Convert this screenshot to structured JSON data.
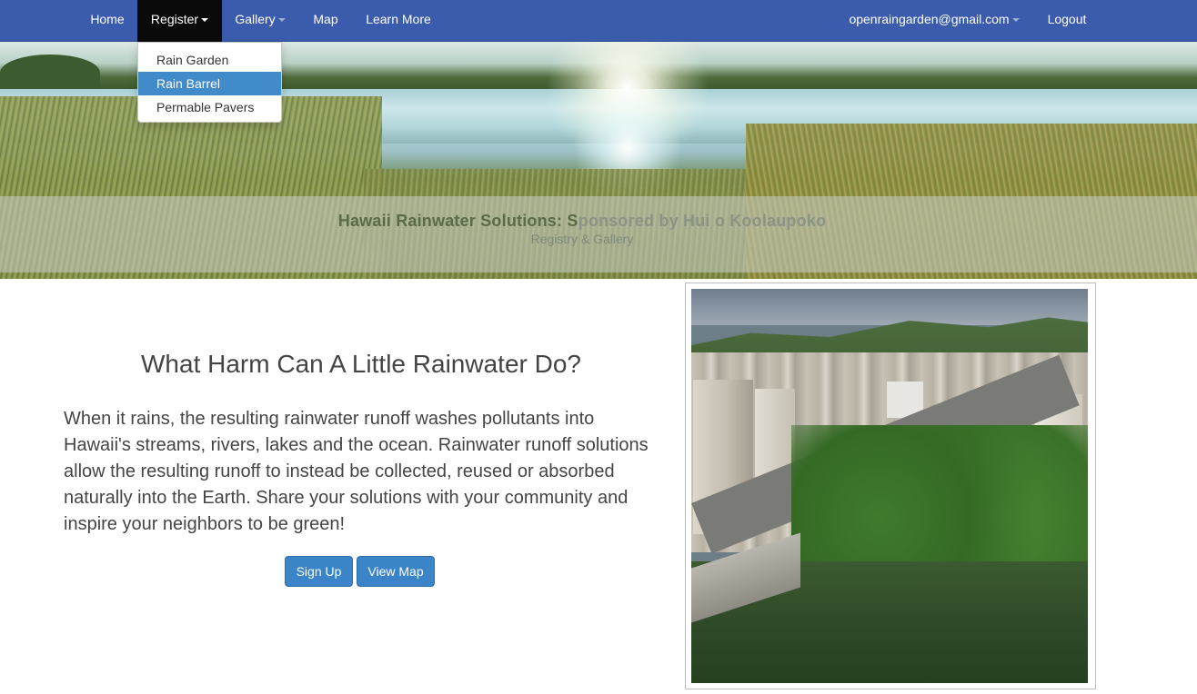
{
  "navbar": {
    "items": [
      {
        "label": "Home"
      },
      {
        "label": "Register"
      },
      {
        "label": "Gallery"
      },
      {
        "label": "Map"
      },
      {
        "label": "Learn More"
      }
    ],
    "account": "openraingarden@gmail.com",
    "logout": "Logout"
  },
  "dropdown": {
    "items": [
      {
        "label": "Rain Garden"
      },
      {
        "label": "Rain Barrel"
      },
      {
        "label": "Permable Pavers"
      }
    ]
  },
  "hero": {
    "title_part1": "Hawaii Rainwater Solutions: S",
    "title_part2": "ponsored by Hui o Koolaupoko",
    "subtitle": "Registry & Gallery"
  },
  "main": {
    "heading": "What Harm Can A Little Rainwater Do?",
    "paragraph": "When it rains, the resulting rainwater runoff washes pollutants into Hawaii's streams, rivers, lakes and the ocean. Rainwater runoff solutions allow the resulting runoff to instead be collected, reused or absorbed naturally into the Earth. Share your solutions with your community and inspire your neighbors to be green!",
    "signup": "Sign Up",
    "viewmap": "View Map"
  }
}
